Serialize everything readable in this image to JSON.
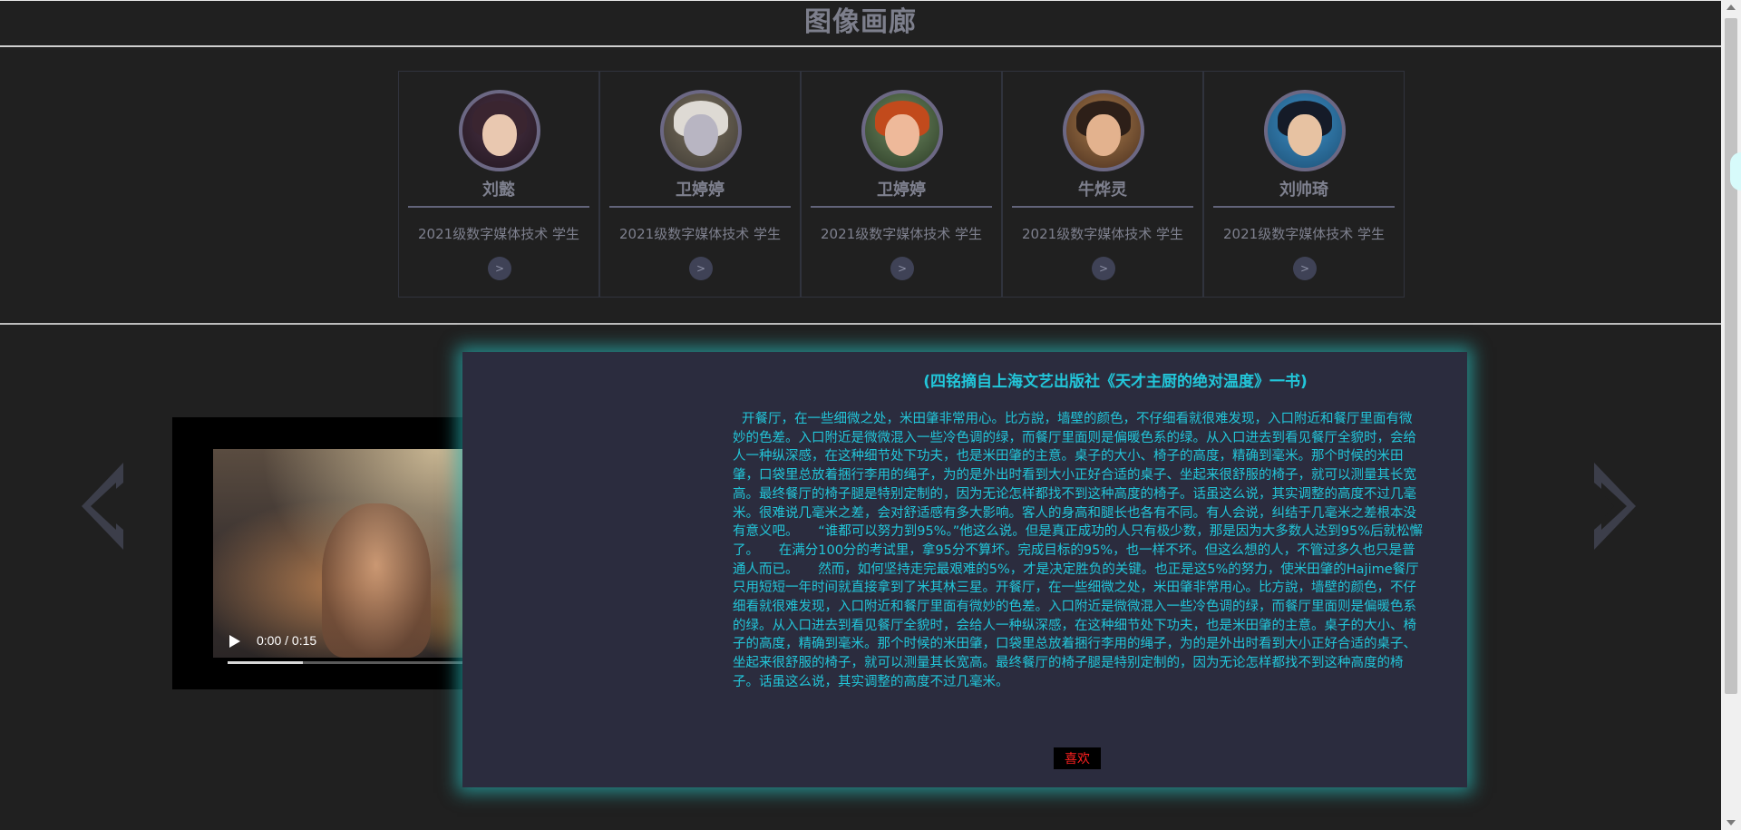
{
  "header": {
    "title": "图像画廊"
  },
  "team": {
    "members": [
      {
        "name": "刘懿",
        "role": "2021级数字媒体技术 学生",
        "button": ">"
      },
      {
        "name": "卫婷婷",
        "role": "2021级数字媒体技术 学生",
        "button": ">"
      },
      {
        "name": "卫婷婷",
        "role": "2021级数字媒体技术 学生",
        "button": ">"
      },
      {
        "name": "牛烨灵",
        "role": "2021级数字媒体技术 学生",
        "button": ">"
      },
      {
        "name": "刘帅琦",
        "role": "2021级数字媒体技术 学生",
        "button": ">"
      }
    ]
  },
  "video": {
    "time": "0:00 / 0:15",
    "progress_fraction": 0.22
  },
  "article": {
    "title": "(四铭摘自上海文艺出版社《天才主厨的绝对温度》一书)",
    "body": "开餐厅，在一些细微之处，米田肇非常用心。比方說，墙壁的颜色，不仔细看就很难发现，入口附近和餐厅里面有微妙的色差。入口附近是微微混入一些冷色调的绿，而餐厅里面则是偏暖色系的绿。从入口进去到看见餐厅全貌时，会给人一种纵深感，在这种细节处下功夫，也是米田肇的主意。桌子的大小、椅子的高度，精确到毫米。那个时候的米田肇，口袋里总放着捆行李用的绳子，为的是外出时看到大小正好合适的桌子、坐起来很舒服的椅子，就可以测量其长宽高。最终餐厅的椅子腿是特别定制的，因为无论怎样都找不到这种高度的椅子。话虽这么说，其实调整的高度不过几毫米。很难说几毫米之差，会对舒适感有多大影响。客人的身高和腿长也各有不同。有人会说，纠结于几毫米之差根本没有意义吧。　　“谁都可以努力到95%。”他这么说。但是真正成功的人只有极少数，那是因为大多数人达到95%后就松懈了。　　在满分100分的考试里，拿95分不算坏。完成目标的95%，也一样不坏。但这么想的人，不管过多久也只是普通人而已。　　然而，如何坚持走完最艰难的5%，才是决定胜负的关键。也正是这5%的努力，使米田肇的Hajime餐厅只用短短一年时间就直接拿到了米其林三星。开餐厅，在一些细微之处，米田肇非常用心。比方說，墙壁的颜色，不仔细看就很难发现，入口附近和餐厅里面有微妙的色差。入口附近是微微混入一些冷色调的绿，而餐厅里面则是偏暖色系的绿。从入口进去到看见餐厅全貌时，会给人一种纵深感，在这种细节处下功夫，也是米田肇的主意。桌子的大小、椅子的高度，精确到毫米。那个时候的米田肇，口袋里总放着捆行李用的绳子，为的是外出时看到大小正好合适的桌子、坐起来很舒服的椅子，就可以测量其长宽高。最终餐厅的椅子腿是特别定制的，因为无论怎样都找不到这种高度的椅子。话虽这么说，其实调整的高度不过几毫米。",
    "like_label": "喜欢"
  },
  "colors": {
    "background": "#202020",
    "accent_text": "#22c6d9",
    "card_text": "#7e808e",
    "like_text": "#ff2020",
    "glow": "#28bebe"
  },
  "icons": {
    "prev": "chevron-left-icon",
    "next": "chevron-right-icon",
    "play": "play-icon",
    "volume": "volume-icon",
    "fullscreen": "fullscreen-icon",
    "more": "more-vertical-icon"
  }
}
